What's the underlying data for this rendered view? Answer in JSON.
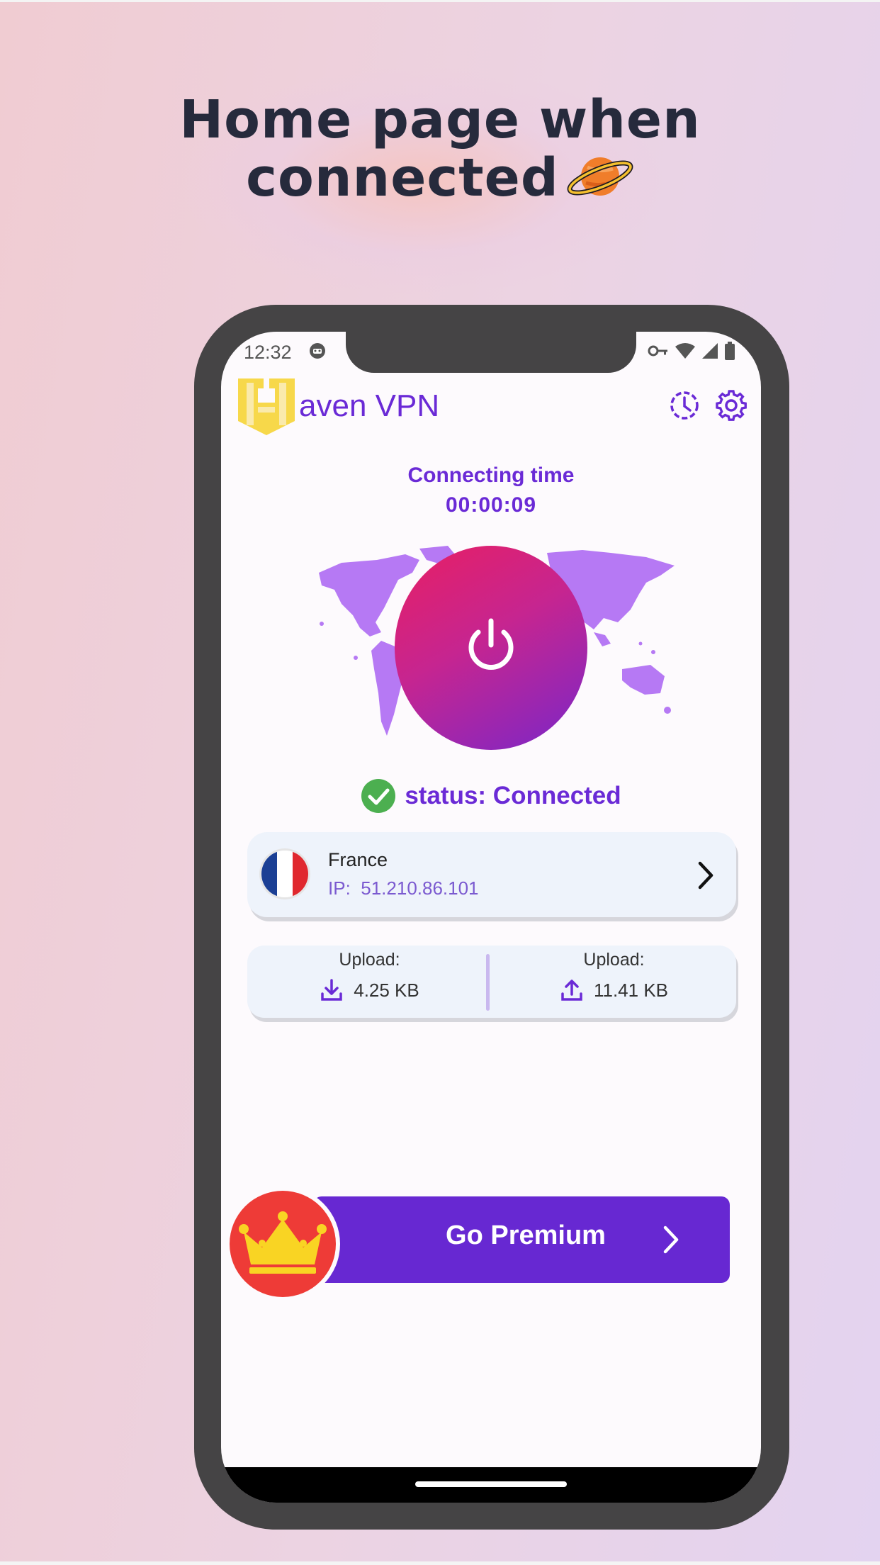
{
  "headline": {
    "line1": "Home page when",
    "line2": "connected"
  },
  "status_bar": {
    "time": "12:32"
  },
  "app": {
    "brand_rest": "aven VPN",
    "connecting_label": "Connecting time",
    "connecting_timer": "00:00:09",
    "status_text": "status: Connected",
    "server": {
      "country": "France",
      "ip_label": "IP:",
      "ip_value": "51.210.86.101"
    },
    "traffic": {
      "download_label": "Upload:",
      "download_value": "4.25 KB",
      "upload_label": "Upload:",
      "upload_value": "11.41 KB"
    },
    "premium_label": "Go Premium"
  },
  "colors": {
    "accent": "#6a2ad6",
    "power_start": "#e81f63",
    "power_end": "#7a27c8",
    "success": "#4caf50",
    "crown_bg": "#ee3b37",
    "crown": "#f9d423"
  },
  "icons": [
    "planet-icon",
    "face-icon",
    "vpn-key-icon",
    "wifi-icon",
    "signal-icon",
    "battery-icon",
    "history-icon",
    "settings-gear-icon",
    "power-icon",
    "check-circle-icon",
    "chevron-right-icon",
    "download-icon",
    "upload-icon",
    "crown-icon"
  ]
}
